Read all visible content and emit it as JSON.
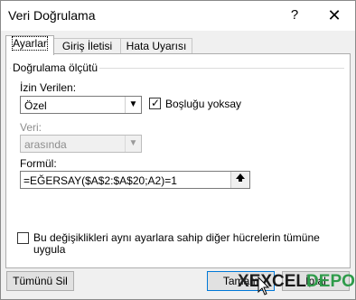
{
  "window": {
    "title": "Veri Doğrulama",
    "help_glyph": "?",
    "close_glyph": "✕"
  },
  "tabs": [
    {
      "label": "Ayarlar",
      "active": true
    },
    {
      "label": "Giriş İletisi",
      "active": false
    },
    {
      "label": "Hata Uyarısı",
      "active": false
    }
  ],
  "criteria": {
    "group_label": "Doğrulama ölçütü",
    "allow_label": "İzin Verilen:",
    "allow_value": "Özel",
    "ignore_blank_label": "Boşluğu yoksay",
    "ignore_blank_checked": true,
    "data_label": "Veri:",
    "data_value": "arasında",
    "formula_label": "Formül:",
    "formula_value": "=EĞERSAY($A$2:$A$20;A2)=1"
  },
  "apply_all": {
    "label_line1": "Bu değişiklikleri aynı ayarlara sahip diğer hücrelerin tümüne",
    "label_line2": "uygula",
    "checked": false
  },
  "buttons": {
    "clear_all": "Tümünü Sil",
    "ok": "Tamam",
    "cancel": "İptal"
  },
  "watermark": {
    "x": "X",
    "excel": "EXCEL",
    "depo": "DEPO",
    "color_excel": "#1a1a1a",
    "color_depo": "#2e9b4a"
  },
  "colors": {
    "accent": "#0078d7"
  }
}
